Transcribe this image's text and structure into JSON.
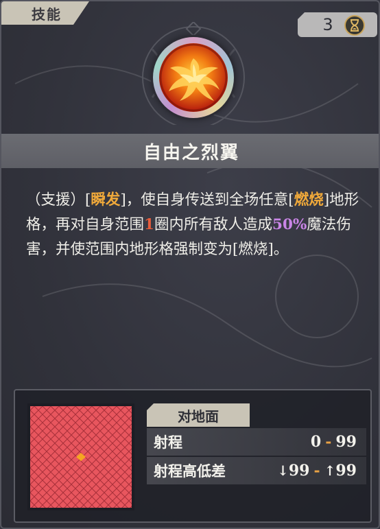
{
  "tab": {
    "label": "技能"
  },
  "cost": {
    "value": "3",
    "icon": "hourglass-icon"
  },
  "skill": {
    "icon": "phoenix-icon",
    "name": "自由之烈翼"
  },
  "description": {
    "p1": "（支援）[",
    "k1": "瞬发",
    "p2": "]，使自身传送到全场任意[",
    "k2": "燃烧",
    "p3": "]地形格，再对自身范围",
    "k3": "1",
    "p4": "圈内所有敌人造成",
    "k4": "50%",
    "p5": "魔法伤害，并使范围内地形格强制变为[燃烧]。"
  },
  "target": {
    "tag": "对地面"
  },
  "range": {
    "label": "射程",
    "min": "0",
    "sep": "-",
    "max": "99"
  },
  "height_diff": {
    "label": "射程高低差",
    "down_icon": "arrow-down-icon",
    "down": "99",
    "sep": "-",
    "up_icon": "arrow-up-icon",
    "up": "99"
  },
  "colors": {
    "keyword": "#f0a93a",
    "range_number": "#e85c3b",
    "percent": "#c985e6",
    "grid_fill": "#e8565e",
    "grid_center": "#f5a623"
  }
}
